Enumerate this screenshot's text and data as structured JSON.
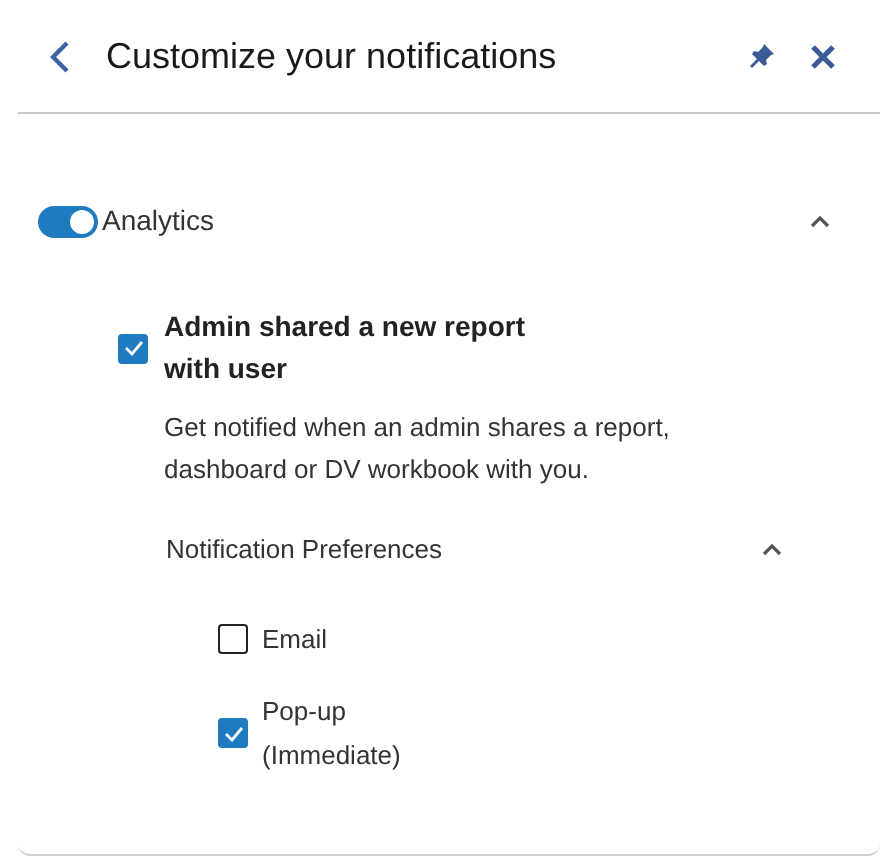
{
  "header": {
    "title": "Customize your notifications"
  },
  "section": {
    "label": "Analytics",
    "on": true,
    "expanded": true,
    "notification": {
      "title": "Admin shared a new report with user",
      "checked": true,
      "description": "Get notified when an admin shares a report, dashboard or DV workbook with you.",
      "preferences": {
        "label": "Notification Preferences",
        "expanded": true,
        "options": [
          {
            "label": "Email",
            "checked": false
          },
          {
            "label": "Pop-up (Immediate)",
            "checked": true
          }
        ]
      }
    }
  }
}
